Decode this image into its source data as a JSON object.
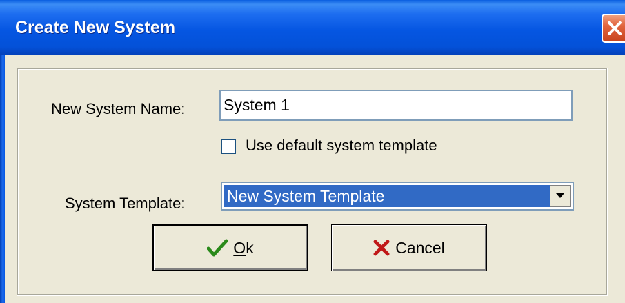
{
  "window": {
    "title": "Create New System"
  },
  "form": {
    "name_label": "New System Name:",
    "name_value": "System 1",
    "use_default_label": "Use default system template",
    "use_default_checked": false,
    "template_label": "System Template:",
    "template_selected": "New System Template"
  },
  "buttons": {
    "ok_access_key": "O",
    "ok_rest": "k",
    "cancel_label": "Cancel"
  },
  "icons": {
    "close": "close-icon",
    "checkmark": "checkmark-icon",
    "cancel": "x-icon",
    "dropdown": "chevron-down-icon"
  },
  "colors": {
    "titlebar": "#0556e2",
    "selection": "#316ac5",
    "check_green": "#2a8a1a",
    "cancel_red": "#c01818"
  }
}
